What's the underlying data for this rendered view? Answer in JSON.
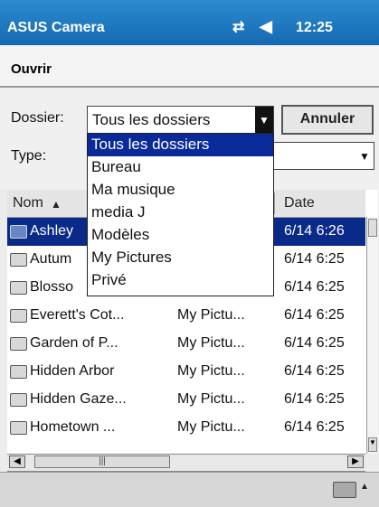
{
  "titlebar": {
    "app_title": "ASUS Camera",
    "connectivity_icon": "⇄",
    "volume_icon": "◀",
    "time": "12:25"
  },
  "dialog": {
    "title": "Ouvrir",
    "folder_label": "Dossier:",
    "folder_value": "Tous les dossiers",
    "cancel_label": "Annuler",
    "type_label": "Type:",
    "type_value": ""
  },
  "dropdown": {
    "options": [
      "Tous les dossiers",
      "Bureau",
      "Ma musique",
      "media J",
      "Modèles",
      "My Pictures",
      "Privé"
    ],
    "selected_index": 0
  },
  "file_list": {
    "columns": [
      "Nom",
      "Date"
    ],
    "sort_indicator": "▲",
    "rows": [
      {
        "name": "Ashley",
        "folder": "",
        "date": "6/14 6:26",
        "selected": true
      },
      {
        "name": "Autum",
        "folder": "",
        "date": "6/14 6:25"
      },
      {
        "name": "Blosso",
        "folder": "",
        "date": "6/14 6:25"
      },
      {
        "name": "Everett's Cot...",
        "folder": "My Pictu...",
        "date": "6/14 6:25"
      },
      {
        "name": "Garden of P...",
        "folder": "My Pictu...",
        "date": "6/14 6:25"
      },
      {
        "name": "Hidden Arbor",
        "folder": "My Pictu...",
        "date": "6/14 6:25"
      },
      {
        "name": "Hidden Gaze...",
        "folder": "My Pictu...",
        "date": "6/14 6:25"
      },
      {
        "name": "Hometown ...",
        "folder": "My Pictu...",
        "date": "6/14 6:25"
      }
    ]
  },
  "scrollbar": {
    "left_arrow": "◀",
    "right_arrow": "▶",
    "thumb_grip": "|||"
  },
  "bottom_bar": {
    "input_icon": "keyboard-icon",
    "input_arrow": "▲"
  },
  "colors": {
    "titlebar": "#1669b3",
    "selection": "#0b2a9a"
  }
}
